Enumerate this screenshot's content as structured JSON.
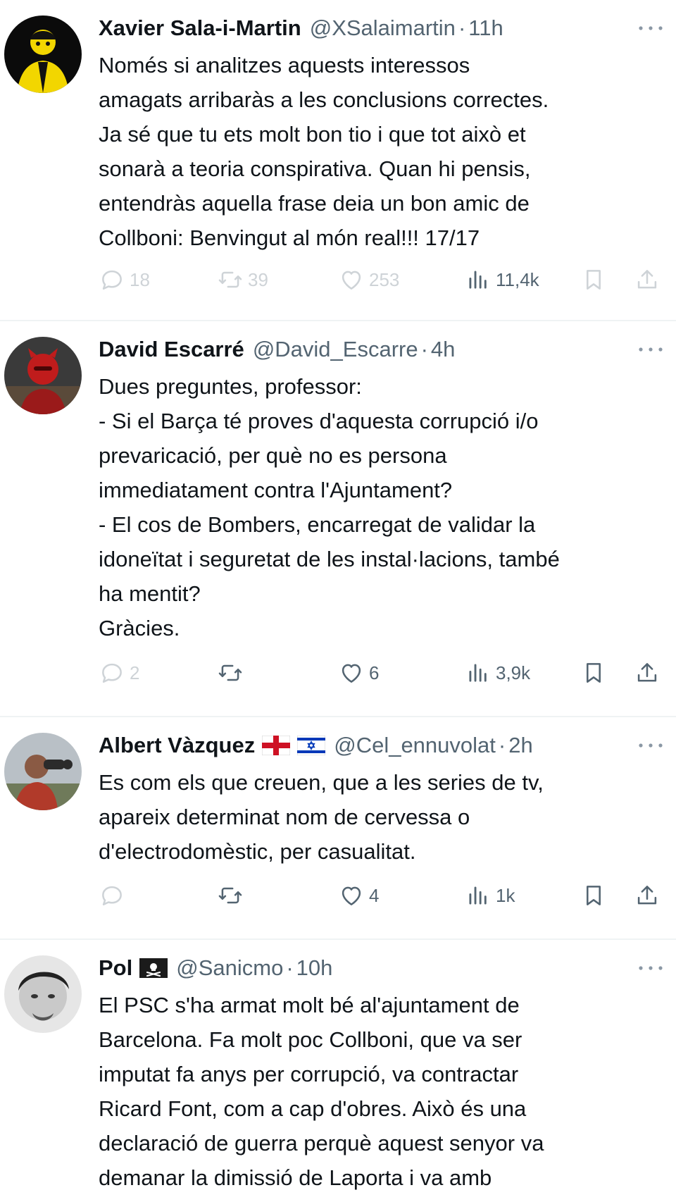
{
  "colors": {
    "text": "#0f1419",
    "secondary": "#536471",
    "divider": "#eff3f4",
    "background": "#ffffff"
  },
  "icons": {
    "reply": "speech-bubble-icon",
    "retweet": "retweet-arrows-icon",
    "like": "heart-icon",
    "views": "bar-chart-icon",
    "bookmark": "bookmark-icon",
    "share": "share-upload-icon",
    "more": "ellipsis-icon"
  },
  "tweets": [
    {
      "name": "Xavier Sala-i-Martin",
      "handle": "@XSalaimartin",
      "sep": "·",
      "time": "11h",
      "text": "Només si analitzes aquests interessos\namagats arribaràs a les conclusions correctes.\nJa sé que tu ets molt bon tio i que tot això et\nsonarà a teoria conspirativa. Quan hi pensis,\nentendràs aquella frase deia un bon amic de\nCollboni: Benvingut al món real!!! 17/17",
      "replies": "18",
      "retweets": "39",
      "likes": "253",
      "views": "11,4k"
    },
    {
      "name": "David Escarré",
      "handle": "@David_Escarre",
      "sep": "·",
      "time": "4h",
      "text": "Dues preguntes, professor:\n- Si el Barça té proves d'aquesta corrupció i/o\nprevaricació, per què no es persona\nimmediatament contra l'Ajuntament?\n- El cos de Bombers, encarregat de validar la\nidoneïtat i seguretat de les instal·lacions, també\nha mentit?\nGràcies.",
      "replies": "2",
      "retweets": "",
      "likes": "6",
      "views": "3,9k"
    },
    {
      "name": "Albert Vàzquez",
      "handle": "@Cel_ennuvolat",
      "sep": "·",
      "time": "2h",
      "text": "Es com els que creuen, que a les series de tv,\napareix determinat nom de cervessa o\nd'electrodomèstic, per casualitat.",
      "replies": "",
      "retweets": "",
      "likes": "4",
      "views": "1k"
    },
    {
      "name": "Pol",
      "handle": "@Sanicmo",
      "sep": "·",
      "time": "10h",
      "text": "El PSC s'ha armat molt bé al'ajuntament de\nBarcelona. Fa molt poc Collboni, que va ser\nimputat fa anys per corrupció, va contractar\nRicard Font, com a cap d'obres. Això és una\ndeclaració de guerra perquè aquest senyor va\ndemanar la dimissió de Laporta i va amb"
    }
  ]
}
